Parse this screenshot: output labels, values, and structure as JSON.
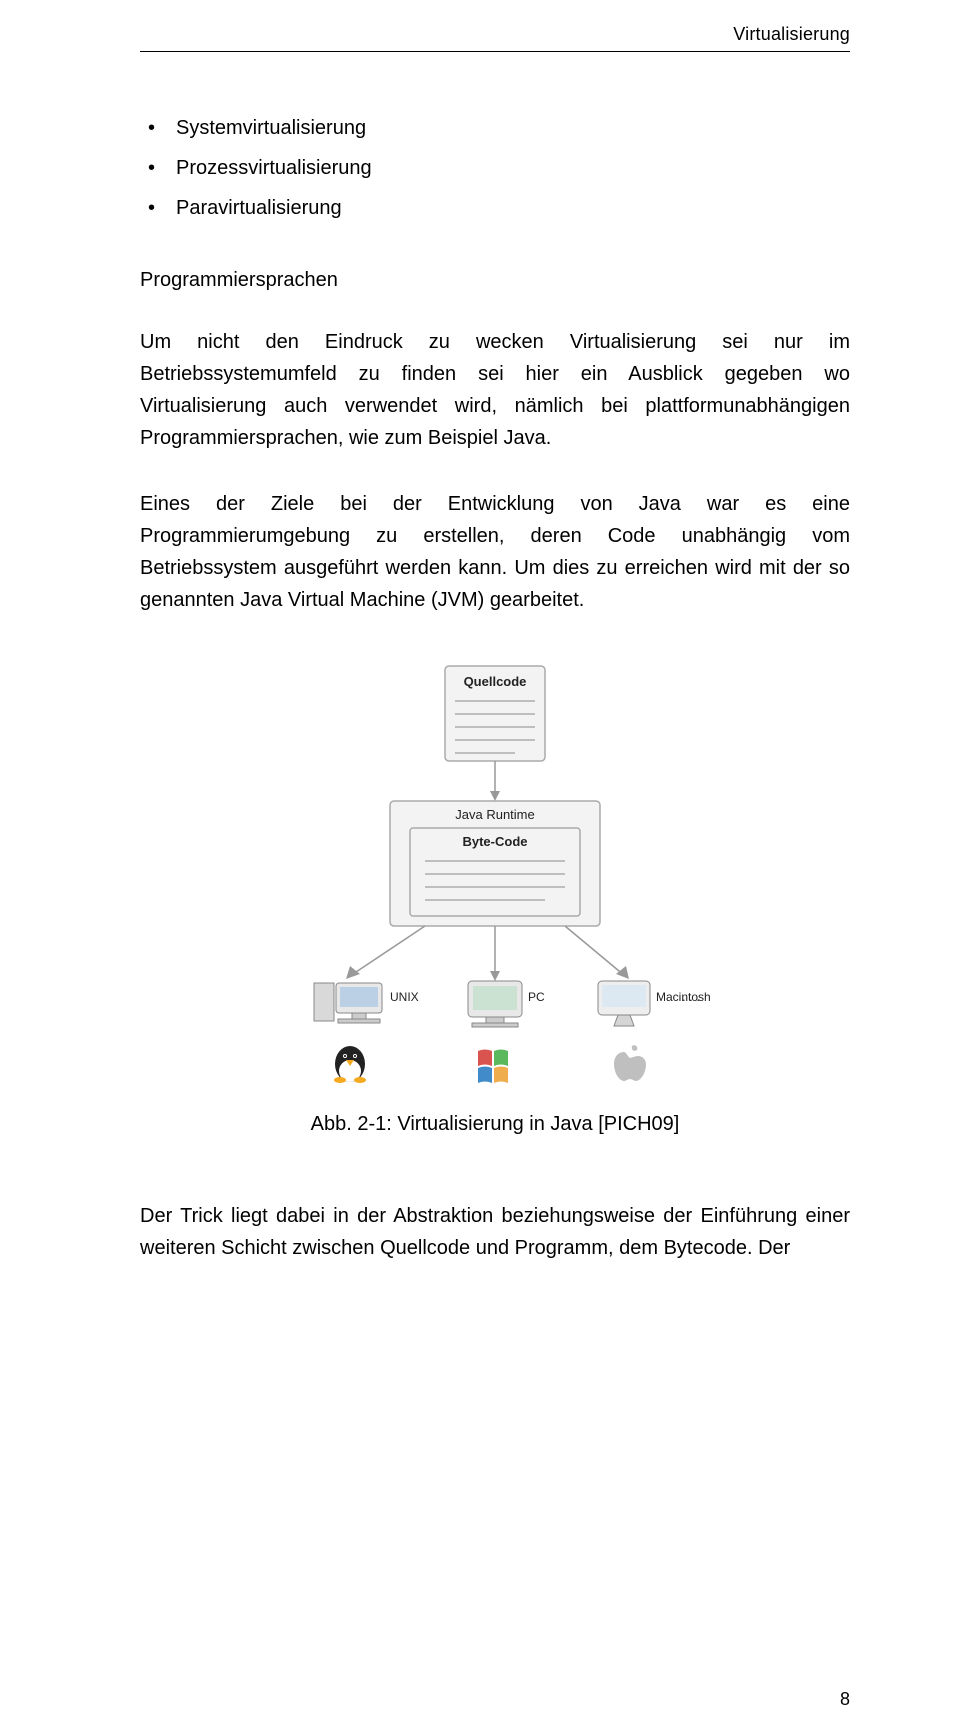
{
  "header_right": "Virtualisierung",
  "bullets": [
    "Systemvirtualisierung",
    "Prozessvirtualisierung",
    "Paravirtualisierung"
  ],
  "section_title": "Programmiersprachen",
  "para1": "Um nicht den Eindruck zu wecken Virtualisierung sei nur im Betriebssystemumfeld zu finden sei hier ein Ausblick gegeben wo Virtualisierung auch verwendet wird, nämlich bei plattformunabhängigen Programmiersprachen, wie zum Beispiel Java.",
  "para2": "Eines der Ziele bei der Entwicklung von Java war es eine Programmierumgebung zu erstellen, deren Code unabhängig vom Betriebssystem ausgeführt werden kann. Um dies zu erreichen wird mit der so genannten Java Virtual Machine (JVM) gearbeitet.",
  "caption": "Abb. 2-1: Virtualisierung in Java [PICH09]",
  "para3": "Der Trick liegt dabei in der Abstraktion beziehungsweise der Einführung einer weiteren Schicht zwischen Quellcode und Programm, dem Bytecode. Der",
  "page_number": "8",
  "diagram": {
    "source_label": "Quellcode",
    "runtime_label": "Java Runtime",
    "bytecode_label": "Byte-Code",
    "platforms": [
      "UNIX",
      "PC",
      "Macintosh"
    ],
    "ellipsis": ". . ."
  }
}
